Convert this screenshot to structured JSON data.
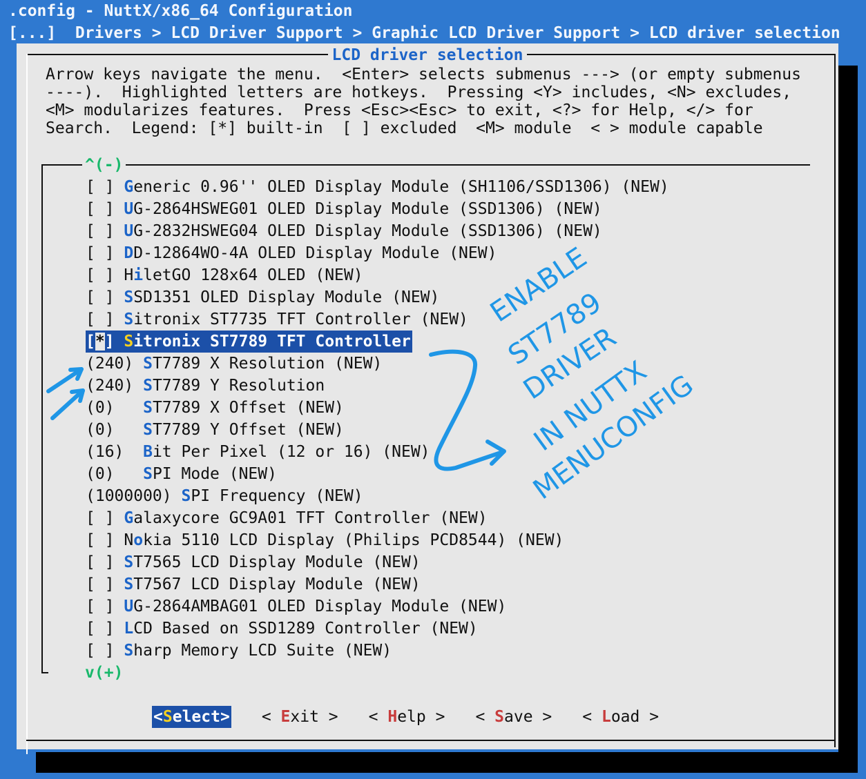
{
  "window": {
    "title": ".config - NuttX/x86_64 Configuration",
    "breadcrumb": "[...]  Drivers > LCD Driver Support > Graphic LCD Driver Support > LCD driver selection"
  },
  "dialog": {
    "title": "LCD driver selection",
    "help_lines": [
      "Arrow keys navigate the menu.  <Enter> selects submenus ---> (or empty submenus",
      "----).  Highlighted letters are hotkeys.  Pressing <Y> includes, <N> excludes,",
      "<M> modularizes features.  Press <Esc><Esc> to exit, <?> for Help, </> for",
      "Search.  Legend: [*] built-in  [ ] excluded  <M> module  < > module capable"
    ],
    "scroll_up": "^(-)",
    "scroll_down": "v(+)"
  },
  "menu_items": [
    {
      "pre": "[ ] ",
      "hot": "G",
      "post": "eneric 0.96'' OLED Display Module (SH1106/SSD1306) (NEW)"
    },
    {
      "pre": "[ ] ",
      "hot": "U",
      "post": "G-2864HSWEG01 OLED Display Module (SSD1306) (NEW)"
    },
    {
      "pre": "[ ] ",
      "hot": "U",
      "post": "G-2832HSWEG04 OLED Display Module (SSD1306) (NEW)"
    },
    {
      "pre": "[ ] ",
      "hot": "D",
      "post": "D-12864WO-4A OLED Display Module (NEW)"
    },
    {
      "pre": "[ ] H",
      "hot": "i",
      "post": "letGO 128x64 OLED (NEW)"
    },
    {
      "pre": "[ ] ",
      "hot": "S",
      "post": "SD1351 OLED Display Module (NEW)"
    },
    {
      "pre": "[ ] ",
      "hot": "S",
      "post": "itronix ST7735 TFT Controller (NEW)"
    },
    {
      "pre": "[*] ",
      "hot": "S",
      "post": "itronix ST7789 TFT Controller",
      "selected": true
    },
    {
      "pre": "(240) ",
      "hot": "S",
      "post": "T7789 X Resolution (NEW)"
    },
    {
      "pre": "(240) ",
      "hot": "S",
      "post": "T7789 Y Resolution"
    },
    {
      "pre": "(0)   ",
      "hot": "S",
      "post": "T7789 X Offset (NEW)"
    },
    {
      "pre": "(0)   ",
      "hot": "S",
      "post": "T7789 Y Offset (NEW)"
    },
    {
      "pre": "(16)  ",
      "hot": "B",
      "post": "it Per Pixel (12 or 16) (NEW)"
    },
    {
      "pre": "(0)   ",
      "hot": "S",
      "post": "PI Mode (NEW)"
    },
    {
      "pre": "(1000000) ",
      "hot": "S",
      "post": "PI Frequency (NEW)"
    },
    {
      "pre": "[ ] ",
      "hot": "G",
      "post": "alaxycore GC9A01 TFT Controller (NEW)"
    },
    {
      "pre": "[ ] N",
      "hot": "o",
      "post": "kia 5110 LCD Display (Philips PCD8544) (NEW)"
    },
    {
      "pre": "[ ] ",
      "hot": "S",
      "post": "T7565 LCD Display Module (NEW)"
    },
    {
      "pre": "[ ] ",
      "hot": "S",
      "post": "T7567 LCD Display Module (NEW)"
    },
    {
      "pre": "[ ] ",
      "hot": "U",
      "post": "G-2864AMBAG01 OLED Display Module (NEW)"
    },
    {
      "pre": "[ ] ",
      "hot": "L",
      "post": "CD Based on SSD1289 Controller (NEW)"
    },
    {
      "pre": "[ ] ",
      "hot": "S",
      "post": "harp Memory LCD Suite (NEW)"
    }
  ],
  "buttons": [
    {
      "pre": "<",
      "hot": "S",
      "post": "elect>",
      "active": true
    },
    {
      "pre": "< ",
      "hot": "E",
      "post": "xit >"
    },
    {
      "pre": "< ",
      "hot": "H",
      "post": "elp >"
    },
    {
      "pre": "< ",
      "hot": "S",
      "post": "ave >"
    },
    {
      "pre": "< ",
      "hot": "L",
      "post": "oad >"
    }
  ],
  "annotation": {
    "lines": [
      "ENABLE",
      "ST7789",
      "DRIVER",
      "IN  NUTTX",
      "MENUCONFIG"
    ],
    "color": "#1f96e6"
  },
  "colors": {
    "background": "#2f79d0",
    "dialog": "#e7e7e7",
    "selection": "#1c50a8",
    "hotkey": "#1c64c8",
    "scroll_indicator": "#19b86b"
  }
}
